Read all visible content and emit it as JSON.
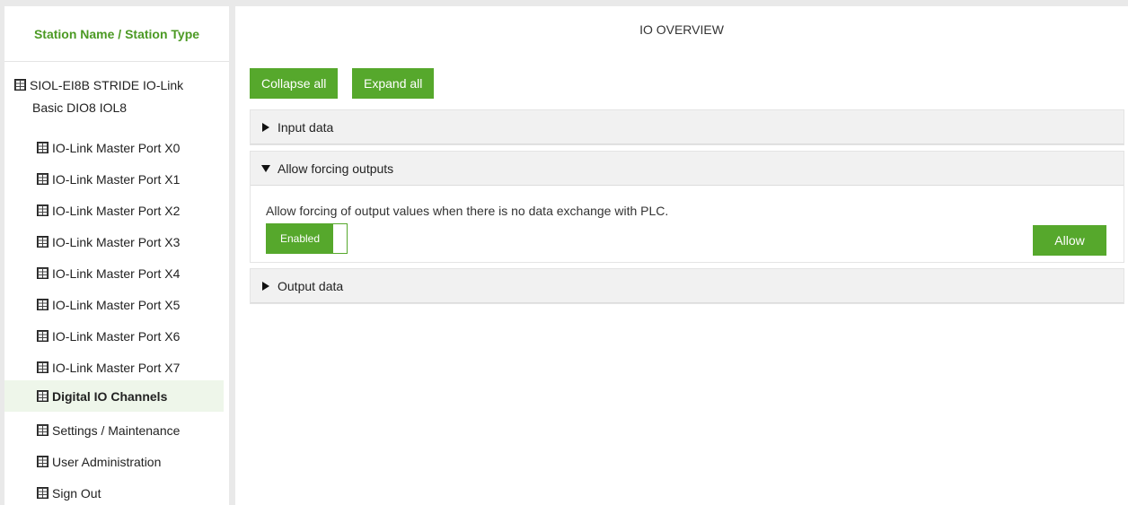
{
  "sidebar": {
    "title": "Station Name / Station Type",
    "station": {
      "line1": "SIOL-EI8B STRIDE IO-Link",
      "line2": "Basic DIO8 IOL8"
    },
    "items": [
      {
        "label": "IO-Link Master Port X0"
      },
      {
        "label": "IO-Link Master Port X1"
      },
      {
        "label": "IO-Link Master Port X2"
      },
      {
        "label": "IO-Link Master Port X3"
      },
      {
        "label": "IO-Link Master Port X4"
      },
      {
        "label": "IO-Link Master Port X5"
      },
      {
        "label": "IO-Link Master Port X6"
      },
      {
        "label": "IO-Link Master Port X7"
      },
      {
        "label": "Digital IO Channels",
        "active": true
      },
      {
        "label": "Settings / Maintenance"
      },
      {
        "label": "User Administration"
      },
      {
        "label": "Sign Out"
      }
    ]
  },
  "main": {
    "title": "IO OVERVIEW",
    "collapse_label": "Collapse all",
    "expand_label": "Expand all",
    "sections": {
      "input": {
        "label": "Input data",
        "expanded": false
      },
      "forcing": {
        "label": "Allow forcing outputs",
        "expanded": true,
        "description": "Allow forcing of output values when there is no data exchange with PLC.",
        "toggle_label": "Enabled",
        "toggle_state": "on",
        "allow_label": "Allow"
      },
      "output": {
        "label": "Output data",
        "expanded": false
      }
    }
  },
  "colors": {
    "accent": "#56a82c",
    "sidebar_title": "#4c9a24",
    "active_item_bg": "#eef6ea",
    "section_header_bg": "#f1f1f1"
  },
  "icons": {
    "tree_node": "device-grid-icon",
    "collapsed": "triangle-right-icon",
    "expanded": "triangle-down-icon"
  }
}
